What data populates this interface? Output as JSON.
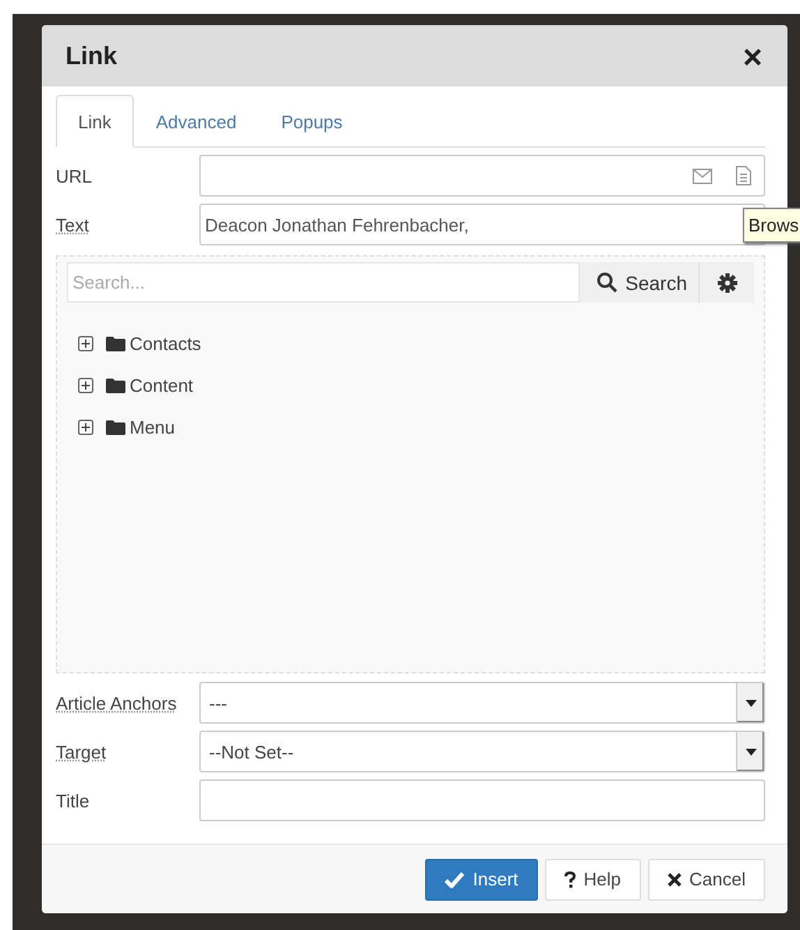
{
  "dialog": {
    "title": "Link",
    "close": "×"
  },
  "tabs": [
    {
      "label": "Link",
      "selected": true
    },
    {
      "label": "Advanced",
      "selected": false
    },
    {
      "label": "Popups",
      "selected": false
    }
  ],
  "url": {
    "label": "URL"
  },
  "text": {
    "label": "Text",
    "value": "Deacon Jonathan Fehrenbacher,"
  },
  "tooltip": "Brows",
  "browser": {
    "search": {
      "placeholder": "Search...",
      "button": "Search"
    },
    "tree": [
      {
        "label": "Contacts",
        "expanded": false
      },
      {
        "label": "Content",
        "expanded": false
      },
      {
        "label": "Menu",
        "expanded": false
      }
    ]
  },
  "fields": [
    {
      "kind": "select",
      "label": "Article Anchors",
      "value": "---"
    },
    {
      "kind": "select",
      "label": "Target",
      "value": "--Not Set--"
    },
    {
      "kind": "input",
      "label": "Title"
    }
  ],
  "buttons": [
    {
      "kind": "primary",
      "label": "Insert"
    },
    {
      "kind": "help",
      "label": "Help"
    },
    {
      "kind": "cancel",
      "label": "Cancel"
    }
  ]
}
